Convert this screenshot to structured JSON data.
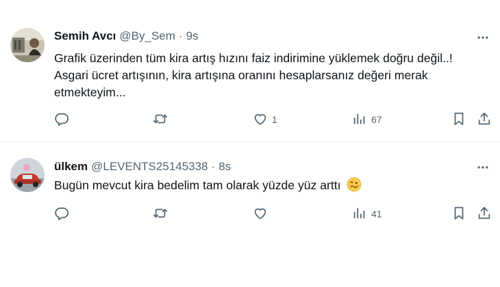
{
  "tweets": [
    {
      "name": "Semih Avcı",
      "handle": "@By_Sem",
      "dot": "·",
      "time": "9s",
      "text_lines": [
        "Grafik üzerinden tüm kira artış hızını faiz indirimine yüklemek doğru değil..!",
        "Asgari ücret artışının, kira artışına oranını hesaplarsanız değeri merak",
        "etmekteyim..."
      ],
      "like_count": "1",
      "view_count": "67"
    },
    {
      "name": "ülkem",
      "handle": "@LEVENTS25145338",
      "dot": "·",
      "time": "8s",
      "text": "Bugün mevcut kira bedelim tam olarak yüzde yüz arttı",
      "emoji": "woozy-face",
      "like_count": "",
      "view_count": "41"
    }
  ],
  "icons": {
    "reply": "reply-icon",
    "retweet": "retweet-icon",
    "like": "heart-icon",
    "views": "views-chart-icon",
    "bookmark": "bookmark-icon",
    "share": "share-icon",
    "more": "more-dots-icon"
  },
  "colors": {
    "text": "#0f1419",
    "secondary": "#536471",
    "divider": "#eff3f4"
  }
}
